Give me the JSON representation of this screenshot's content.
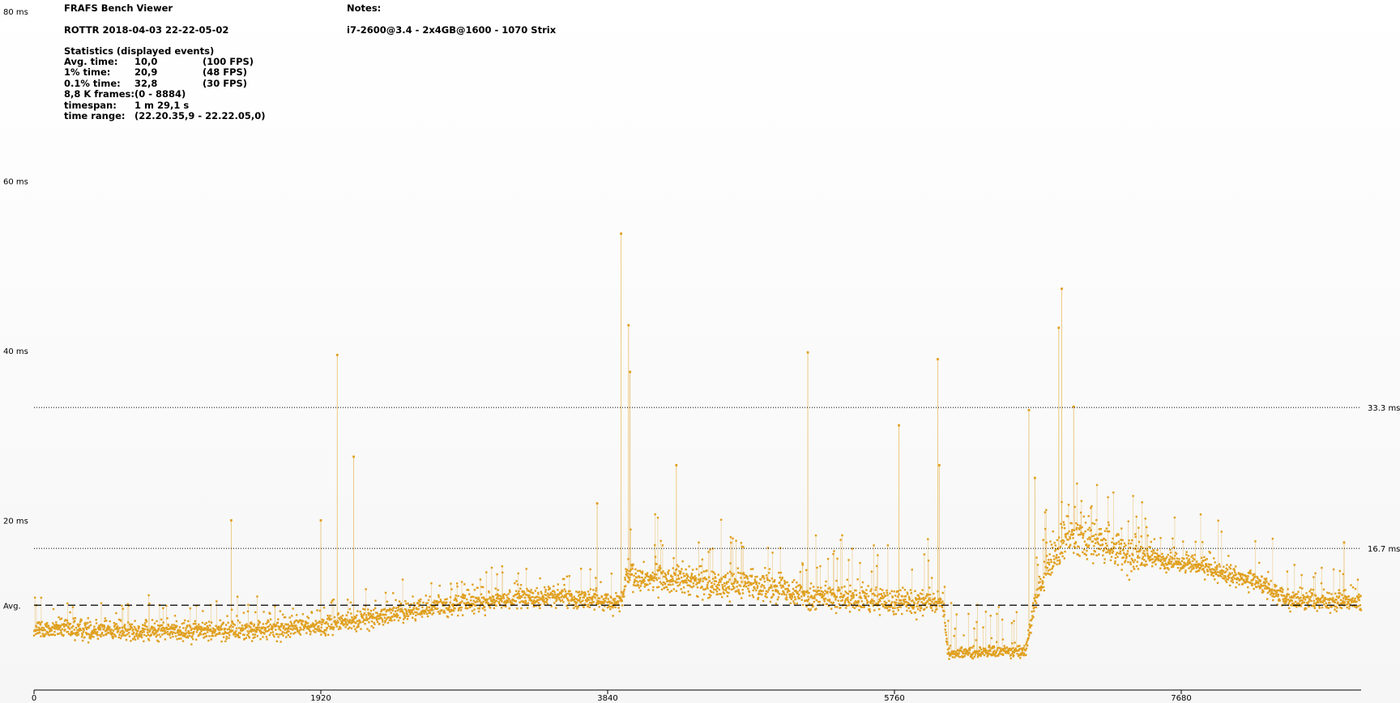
{
  "header": {
    "app_title": "FRAFS Bench Viewer",
    "run_name": "ROTTR 2018-04-03 22-22-05-02",
    "notes_label": "Notes:",
    "notes_text": "i7-2600@3.4 - 2x4GB@1600 - 1070 Strix",
    "stats_heading": "Statistics (displayed events)"
  },
  "stats": [
    {
      "label": "Avg. time:",
      "value": "10,0",
      "extra": "(100 FPS)"
    },
    {
      "label": "1% time:",
      "value": "20,9",
      "extra": "(48 FPS)"
    },
    {
      "label": "0.1% time:",
      "value": "32,8",
      "extra": "(30 FPS)"
    },
    {
      "label": "8,8 K frames:",
      "value": "(0 - 8884)",
      "extra": ""
    },
    {
      "label": "timespan:",
      "value": "1 m 29,1 s",
      "extra": ""
    },
    {
      "label": "time range:",
      "value": "(22.20.35,9 - 22.22.05,0)",
      "extra": ""
    }
  ],
  "colors": {
    "series": "#e0a020",
    "reference_line": "#000000",
    "axis": "#000000"
  },
  "chart_data": {
    "type": "scatter",
    "title": "",
    "xlabel": "",
    "ylabel": "",
    "xlim": [
      0,
      8884
    ],
    "ylim": [
      0,
      80
    ],
    "y_ticks": [
      {
        "value": 80,
        "label": "80 ms"
      },
      {
        "value": 60,
        "label": "60 ms"
      },
      {
        "value": 40,
        "label": "40 ms"
      },
      {
        "value": 20,
        "label": "20 ms"
      }
    ],
    "x_ticks": [
      {
        "value": 0,
        "label": "0"
      },
      {
        "value": 1920,
        "label": "1920"
      },
      {
        "value": 3840,
        "label": "3840"
      },
      {
        "value": 5760,
        "label": "5760"
      },
      {
        "value": 7680,
        "label": "7680"
      }
    ],
    "reference_lines": [
      {
        "value": 33.3,
        "label": "33.3 ms",
        "style": "dotted",
        "label_side": "right"
      },
      {
        "value": 16.7,
        "label": "16.7 ms",
        "style": "dotted",
        "label_side": "right"
      },
      {
        "value": 10.0,
        "label": "Avg.",
        "style": "dashed",
        "label_side": "left"
      }
    ],
    "series_baseline": [
      {
        "frame": 0,
        "ms": 7.2
      },
      {
        "frame": 700,
        "ms": 7.0
      },
      {
        "frame": 1400,
        "ms": 7.0
      },
      {
        "frame": 1900,
        "ms": 7.6
      },
      {
        "frame": 2200,
        "ms": 8.3
      },
      {
        "frame": 2600,
        "ms": 9.6
      },
      {
        "frame": 3000,
        "ms": 10.4
      },
      {
        "frame": 3500,
        "ms": 11.0
      },
      {
        "frame": 3930,
        "ms": 10.3
      },
      {
        "frame": 3970,
        "ms": 13.2
      },
      {
        "frame": 4500,
        "ms": 12.7
      },
      {
        "frame": 5000,
        "ms": 12.2
      },
      {
        "frame": 5150,
        "ms": 11.2
      },
      {
        "frame": 5500,
        "ms": 10.6
      },
      {
        "frame": 5900,
        "ms": 10.4
      },
      {
        "frame": 6080,
        "ms": 10.5
      },
      {
        "frame": 6120,
        "ms": 4.4
      },
      {
        "frame": 6640,
        "ms": 4.6
      },
      {
        "frame": 6700,
        "ms": 10.6
      },
      {
        "frame": 6800,
        "ms": 15.0
      },
      {
        "frame": 6950,
        "ms": 18.8
      },
      {
        "frame": 7300,
        "ms": 16.2
      },
      {
        "frame": 7800,
        "ms": 14.5
      },
      {
        "frame": 8200,
        "ms": 12.7
      },
      {
        "frame": 8400,
        "ms": 10.6
      },
      {
        "frame": 8884,
        "ms": 10.4
      }
    ],
    "spikes": [
      {
        "frame": 1320,
        "ms": 20.0
      },
      {
        "frame": 1920,
        "ms": 20.0
      },
      {
        "frame": 2030,
        "ms": 39.5
      },
      {
        "frame": 2140,
        "ms": 27.5
      },
      {
        "frame": 3770,
        "ms": 22.0
      },
      {
        "frame": 3930,
        "ms": 53.8
      },
      {
        "frame": 3980,
        "ms": 43.0
      },
      {
        "frame": 3990,
        "ms": 37.5
      },
      {
        "frame": 4300,
        "ms": 26.5
      },
      {
        "frame": 5180,
        "ms": 39.8
      },
      {
        "frame": 5790,
        "ms": 31.2
      },
      {
        "frame": 6050,
        "ms": 39.0
      },
      {
        "frame": 6060,
        "ms": 26.5
      },
      {
        "frame": 6660,
        "ms": 33.0
      },
      {
        "frame": 6700,
        "ms": 25.0
      },
      {
        "frame": 6860,
        "ms": 42.7
      },
      {
        "frame": 6880,
        "ms": 47.3
      },
      {
        "frame": 6960,
        "ms": 33.4
      },
      {
        "frame": 8770,
        "ms": 17.4
      }
    ]
  }
}
